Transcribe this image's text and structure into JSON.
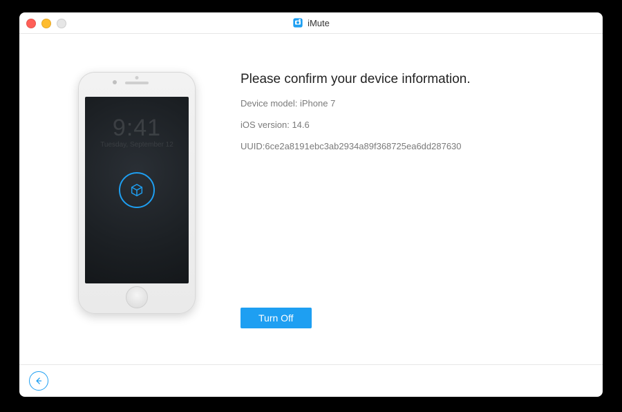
{
  "app": {
    "title": "iMute"
  },
  "main": {
    "heading": "Please confirm your device information.",
    "device_model_label": "Device model:",
    "device_model_value": "iPhone 7",
    "ios_label": "iOS version:",
    "ios_value": "14.6",
    "uuid_label": "UUID:",
    "uuid_value": "6ce2a8191ebc3ab2934a89f368725ea6dd287630",
    "turn_off_label": "Turn Off"
  },
  "phone": {
    "clock": "9:41",
    "date": "Tuesday, September 12"
  },
  "colors": {
    "accent": "#1e9ff2"
  }
}
